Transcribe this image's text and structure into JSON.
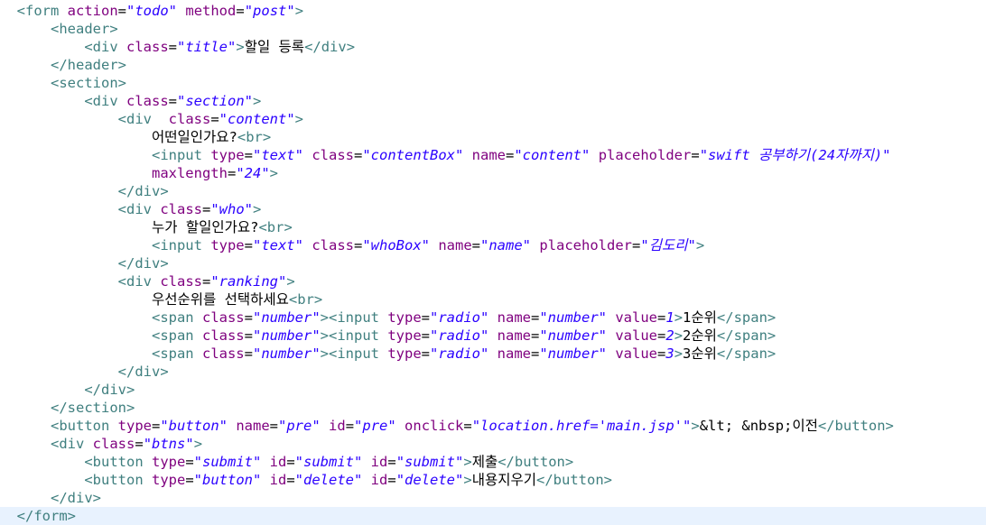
{
  "editor": {
    "colors": {
      "tag": "#3f7f7f",
      "attr": "#7f007f",
      "value": "#2a00ff",
      "text": "#000000",
      "current_line": "#e8f2fe"
    },
    "current_line": 28,
    "lines": [
      {
        "indent": "  ",
        "tokens": [
          [
            "tag",
            "<form "
          ],
          [
            "attr",
            "action"
          ],
          [
            "txt",
            "="
          ],
          [
            "val",
            "\"todo\""
          ],
          [
            "txt",
            " "
          ],
          [
            "attr",
            "method"
          ],
          [
            "txt",
            "="
          ],
          [
            "val",
            "\"post\""
          ],
          [
            "tag",
            ">"
          ]
        ]
      },
      {
        "indent": "      ",
        "tokens": [
          [
            "tag",
            "<header>"
          ]
        ]
      },
      {
        "indent": "          ",
        "tokens": [
          [
            "tag",
            "<div "
          ],
          [
            "attr",
            "class"
          ],
          [
            "txt",
            "="
          ],
          [
            "val",
            "\"title\""
          ],
          [
            "tag",
            ">"
          ],
          [
            "txt",
            "할일 등록"
          ],
          [
            "tag",
            "</div>"
          ]
        ]
      },
      {
        "indent": "      ",
        "tokens": [
          [
            "tag",
            "</header>"
          ]
        ]
      },
      {
        "indent": "      ",
        "tokens": [
          [
            "tag",
            "<section>"
          ]
        ]
      },
      {
        "indent": "          ",
        "tokens": [
          [
            "tag",
            "<div "
          ],
          [
            "attr",
            "class"
          ],
          [
            "txt",
            "="
          ],
          [
            "val",
            "\"section\""
          ],
          [
            "tag",
            ">"
          ]
        ]
      },
      {
        "indent": "              ",
        "tokens": [
          [
            "tag",
            "<div  "
          ],
          [
            "attr",
            "class"
          ],
          [
            "txt",
            "="
          ],
          [
            "val",
            "\"content\""
          ],
          [
            "tag",
            ">"
          ]
        ]
      },
      {
        "indent": "                  ",
        "tokens": [
          [
            "txt",
            "어떤일인가요?"
          ],
          [
            "tag",
            "<br>"
          ]
        ]
      },
      {
        "indent": "                  ",
        "tokens": [
          [
            "tag",
            "<input "
          ],
          [
            "attr",
            "type"
          ],
          [
            "txt",
            "="
          ],
          [
            "val",
            "\"text\""
          ],
          [
            "txt",
            " "
          ],
          [
            "attr",
            "class"
          ],
          [
            "txt",
            "="
          ],
          [
            "val",
            "\"contentBox\""
          ],
          [
            "txt",
            " "
          ],
          [
            "attr",
            "name"
          ],
          [
            "txt",
            "="
          ],
          [
            "val",
            "\"content\""
          ],
          [
            "txt",
            " "
          ],
          [
            "attr",
            "placeholder"
          ],
          [
            "txt",
            "="
          ],
          [
            "val",
            "\"swift 공부하기(24자까지)\""
          ]
        ]
      },
      {
        "indent": "                  ",
        "tokens": [
          [
            "attr",
            "maxlength"
          ],
          [
            "txt",
            "="
          ],
          [
            "val",
            "\"24\""
          ],
          [
            "tag",
            ">"
          ]
        ]
      },
      {
        "indent": "              ",
        "tokens": [
          [
            "tag",
            "</div>"
          ]
        ]
      },
      {
        "indent": "              ",
        "tokens": [
          [
            "tag",
            "<div "
          ],
          [
            "attr",
            "class"
          ],
          [
            "txt",
            "="
          ],
          [
            "val",
            "\"who\""
          ],
          [
            "tag",
            ">"
          ]
        ]
      },
      {
        "indent": "                  ",
        "tokens": [
          [
            "txt",
            "누가 할일인가요?"
          ],
          [
            "tag",
            "<br>"
          ]
        ]
      },
      {
        "indent": "                  ",
        "tokens": [
          [
            "tag",
            "<input "
          ],
          [
            "attr",
            "type"
          ],
          [
            "txt",
            "="
          ],
          [
            "val",
            "\"text\""
          ],
          [
            "txt",
            " "
          ],
          [
            "attr",
            "class"
          ],
          [
            "txt",
            "="
          ],
          [
            "val",
            "\"whoBox\""
          ],
          [
            "txt",
            " "
          ],
          [
            "attr",
            "name"
          ],
          [
            "txt",
            "="
          ],
          [
            "val",
            "\"name\""
          ],
          [
            "txt",
            " "
          ],
          [
            "attr",
            "placeholder"
          ],
          [
            "txt",
            "="
          ],
          [
            "val",
            "\"김도리\""
          ],
          [
            "tag",
            ">"
          ]
        ]
      },
      {
        "indent": "              ",
        "tokens": [
          [
            "tag",
            "</div>"
          ]
        ]
      },
      {
        "indent": "              ",
        "tokens": [
          [
            "tag",
            "<div "
          ],
          [
            "attr",
            "class"
          ],
          [
            "txt",
            "="
          ],
          [
            "val",
            "\"ranking\""
          ],
          [
            "tag",
            ">"
          ]
        ]
      },
      {
        "indent": "                  ",
        "tokens": [
          [
            "txt",
            "우선순위를 선택하세요"
          ],
          [
            "tag",
            "<br>"
          ]
        ]
      },
      {
        "indent": "                  ",
        "tokens": [
          [
            "tag",
            "<span "
          ],
          [
            "attr",
            "class"
          ],
          [
            "txt",
            "="
          ],
          [
            "val",
            "\"number\""
          ],
          [
            "tag",
            ">"
          ],
          [
            "tag",
            "<input "
          ],
          [
            "attr",
            "type"
          ],
          [
            "txt",
            "="
          ],
          [
            "val",
            "\"radio\""
          ],
          [
            "txt",
            " "
          ],
          [
            "attr",
            "name"
          ],
          [
            "txt",
            "="
          ],
          [
            "val",
            "\"number\""
          ],
          [
            "txt",
            " "
          ],
          [
            "attr",
            "value"
          ],
          [
            "txt",
            "="
          ],
          [
            "val",
            "1"
          ],
          [
            "tag",
            ">"
          ],
          [
            "txt",
            "1순위"
          ],
          [
            "tag",
            "</span>"
          ]
        ]
      },
      {
        "indent": "                  ",
        "tokens": [
          [
            "tag",
            "<span "
          ],
          [
            "attr",
            "class"
          ],
          [
            "txt",
            "="
          ],
          [
            "val",
            "\"number\""
          ],
          [
            "tag",
            ">"
          ],
          [
            "tag",
            "<input "
          ],
          [
            "attr",
            "type"
          ],
          [
            "txt",
            "="
          ],
          [
            "val",
            "\"radio\""
          ],
          [
            "txt",
            " "
          ],
          [
            "attr",
            "name"
          ],
          [
            "txt",
            "="
          ],
          [
            "val",
            "\"number\""
          ],
          [
            "txt",
            " "
          ],
          [
            "attr",
            "value"
          ],
          [
            "txt",
            "="
          ],
          [
            "val",
            "2"
          ],
          [
            "tag",
            ">"
          ],
          [
            "txt",
            "2순위"
          ],
          [
            "tag",
            "</span>"
          ]
        ]
      },
      {
        "indent": "                  ",
        "tokens": [
          [
            "tag",
            "<span "
          ],
          [
            "attr",
            "class"
          ],
          [
            "txt",
            "="
          ],
          [
            "val",
            "\"number\""
          ],
          [
            "tag",
            ">"
          ],
          [
            "tag",
            "<input "
          ],
          [
            "attr",
            "type"
          ],
          [
            "txt",
            "="
          ],
          [
            "val",
            "\"radio\""
          ],
          [
            "txt",
            " "
          ],
          [
            "attr",
            "name"
          ],
          [
            "txt",
            "="
          ],
          [
            "val",
            "\"number\""
          ],
          [
            "txt",
            " "
          ],
          [
            "attr",
            "value"
          ],
          [
            "txt",
            "="
          ],
          [
            "val",
            "3"
          ],
          [
            "tag",
            ">"
          ],
          [
            "txt",
            "3순위"
          ],
          [
            "tag",
            "</span>"
          ]
        ]
      },
      {
        "indent": "              ",
        "tokens": [
          [
            "tag",
            "</div>"
          ]
        ]
      },
      {
        "indent": "          ",
        "tokens": [
          [
            "tag",
            "</div>"
          ]
        ]
      },
      {
        "indent": "      ",
        "tokens": [
          [
            "tag",
            "</section>"
          ]
        ]
      },
      {
        "indent": "      ",
        "tokens": [
          [
            "tag",
            "<button "
          ],
          [
            "attr",
            "type"
          ],
          [
            "txt",
            "="
          ],
          [
            "val",
            "\"button\""
          ],
          [
            "txt",
            " "
          ],
          [
            "attr",
            "name"
          ],
          [
            "txt",
            "="
          ],
          [
            "val",
            "\"pre\""
          ],
          [
            "txt",
            " "
          ],
          [
            "attr",
            "id"
          ],
          [
            "txt",
            "="
          ],
          [
            "val",
            "\"pre\""
          ],
          [
            "txt",
            " "
          ],
          [
            "attr",
            "onclick"
          ],
          [
            "txt",
            "="
          ],
          [
            "val",
            "\"location.href='main.jsp'\""
          ],
          [
            "tag",
            ">"
          ],
          [
            "txt",
            "&lt; &nbsp;이전"
          ],
          [
            "tag",
            "</button>"
          ]
        ]
      },
      {
        "indent": "      ",
        "tokens": [
          [
            "tag",
            "<div "
          ],
          [
            "attr",
            "class"
          ],
          [
            "txt",
            "="
          ],
          [
            "val",
            "\"btns\""
          ],
          [
            "tag",
            ">"
          ]
        ]
      },
      {
        "indent": "          ",
        "tokens": [
          [
            "tag",
            "<button "
          ],
          [
            "attr",
            "type"
          ],
          [
            "txt",
            "="
          ],
          [
            "val",
            "\"submit\""
          ],
          [
            "txt",
            " "
          ],
          [
            "attr",
            "id"
          ],
          [
            "txt",
            "="
          ],
          [
            "val",
            "\"submit\""
          ],
          [
            "txt",
            " "
          ],
          [
            "attr",
            "id"
          ],
          [
            "txt",
            "="
          ],
          [
            "val",
            "\"submit\""
          ],
          [
            "tag",
            ">"
          ],
          [
            "txt",
            "제출"
          ],
          [
            "tag",
            "</button>"
          ]
        ]
      },
      {
        "indent": "          ",
        "tokens": [
          [
            "tag",
            "<button "
          ],
          [
            "attr",
            "type"
          ],
          [
            "txt",
            "="
          ],
          [
            "val",
            "\"button\""
          ],
          [
            "txt",
            " "
          ],
          [
            "attr",
            "id"
          ],
          [
            "txt",
            "="
          ],
          [
            "val",
            "\"delete\""
          ],
          [
            "txt",
            " "
          ],
          [
            "attr",
            "id"
          ],
          [
            "txt",
            "="
          ],
          [
            "val",
            "\"delete\""
          ],
          [
            "tag",
            ">"
          ],
          [
            "txt",
            "내용지우기"
          ],
          [
            "tag",
            "</button>"
          ]
        ]
      },
      {
        "indent": "      ",
        "tokens": [
          [
            "tag",
            "</div>"
          ]
        ]
      },
      {
        "indent": "  ",
        "tokens": [
          [
            "tag",
            "</form>"
          ]
        ]
      }
    ]
  }
}
